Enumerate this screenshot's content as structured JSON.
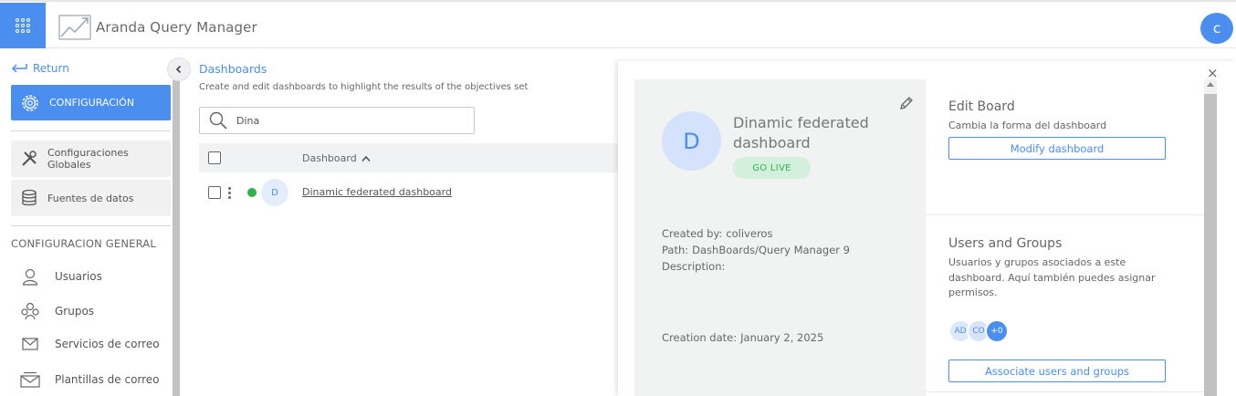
{
  "header": {
    "app_title": "Aranda Query Manager",
    "user_initial": "c",
    "accent_color": "#4a8ef0"
  },
  "sidebar": {
    "return_label": "Return",
    "config_label": "CONFIGURACIÓN",
    "cards": [
      {
        "label": "Configuraciones Globales",
        "icon": "tools-icon"
      },
      {
        "label": "Fuentes de datos",
        "icon": "database-icon"
      }
    ],
    "section_title": "CONFIGURACION GENERAL",
    "items": [
      {
        "label": "Usuarios",
        "icon": "user-icon"
      },
      {
        "label": "Grupos",
        "icon": "group-icon"
      },
      {
        "label": "Servicios de correo",
        "icon": "envelope-icon"
      },
      {
        "label": "Plantillas de correo",
        "icon": "mail-template-icon"
      }
    ]
  },
  "main": {
    "title": "Dashboards",
    "subtitle": "Create and edit dashboards to highlight the results of the objectives set",
    "search_value": "Dina",
    "column_header": "Dashboard",
    "rows": [
      {
        "initial": "D",
        "name": "Dinamic federated dashboard",
        "status_color": "#2db34a"
      }
    ]
  },
  "panel": {
    "initial": "D",
    "name": "Dinamic federated dashboard",
    "status_badge": "GO LIVE",
    "created_by_label": "Created by:",
    "created_by": "coliveros",
    "path_label": "Path:",
    "path": "DashBoards/Query Manager 9",
    "description_label": "Description:",
    "creation_date_label": "Creation date:",
    "creation_date": "January 2, 2025",
    "edit_board": {
      "title": "Edit Board",
      "description": "Cambia la forma del dashboard",
      "button": "Modify dashboard"
    },
    "users_groups": {
      "title": "Users and Groups",
      "description": "Usuarios y grupos asociados a este dashboard. Aquí también puedes asignar permisos.",
      "avatars": [
        "AD",
        "CO"
      ],
      "more_count": "+0",
      "button": "Associate users and groups"
    }
  }
}
